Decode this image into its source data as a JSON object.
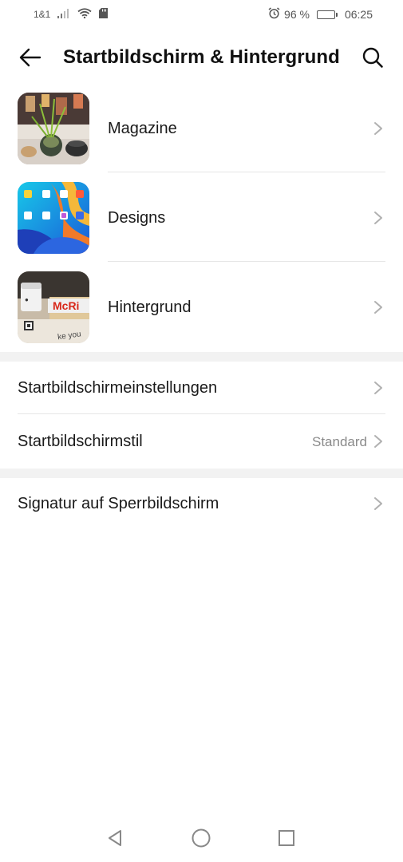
{
  "status_bar": {
    "carrier": "1&1",
    "battery_percent": "96 %",
    "battery_level": 0.96,
    "time": "06:25"
  },
  "header": {
    "title": "Startbildschirm & Hintergrund",
    "back_icon": "arrow-left-icon",
    "search_icon": "search-icon"
  },
  "image_items": [
    {
      "label": "Magazine",
      "thumbnail": "magazine-thumbnail"
    },
    {
      "label": "Designs",
      "thumbnail": "designs-thumbnail"
    },
    {
      "label": "Hintergrund",
      "thumbnail": "hintergrund-thumbnail"
    }
  ],
  "settings_items": [
    {
      "label": "Startbildschirmeinstellungen",
      "value": ""
    },
    {
      "label": "Startbildschirmstil",
      "value": "Standard"
    }
  ],
  "lock_items": [
    {
      "label": "Signatur auf Sperrbildschirm"
    }
  ],
  "thumbnail_text": {
    "mcd": "McRi",
    "you": "ke you"
  },
  "colors": {
    "chevron": "#b0b0b0",
    "section_gap": "#f2f2f2",
    "divider": "#e6e6e6"
  },
  "nav": {
    "back": "triangle-back-icon",
    "home": "circle-home-icon",
    "recents": "square-recents-icon"
  }
}
